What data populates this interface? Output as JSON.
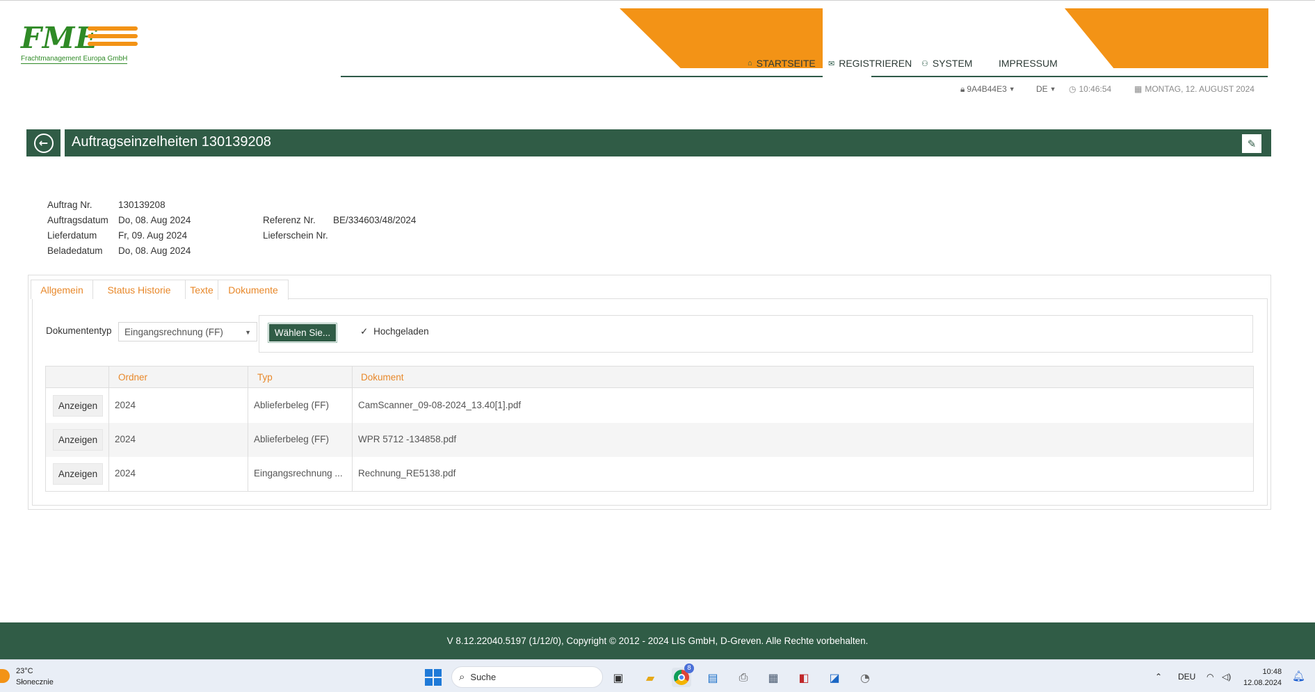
{
  "logo": {
    "mark": "FME",
    "company": "Frachtmanagement Europa GmbH"
  },
  "nav": {
    "home": "STARTSEITE",
    "register": "REGISTRIEREN",
    "system": "SYSTEM",
    "imprint": "IMPRESSUM"
  },
  "status": {
    "user": "9A4B44E3",
    "lang": "DE",
    "time": "10:46:54",
    "date": "MONTAG, 12. AUGUST 2024"
  },
  "page": {
    "title": "Auftragseinzelheiten 130139208"
  },
  "details": {
    "order_no_label": "Auftrag Nr.",
    "order_no": "130139208",
    "order_date_label": "Auftragsdatum",
    "order_date": "Do, 08. Aug 2024",
    "delivery_date_label": "Lieferdatum",
    "delivery_date": "Fr, 09. Aug 2024",
    "loading_date_label": "Beladedatum",
    "loading_date": "Do, 08. Aug 2024",
    "reference_label": "Referenz Nr.",
    "reference": "BE/334603/48/2024",
    "delivery_note_label": "Lieferschein Nr."
  },
  "tabs": [
    "Allgemein",
    "Status Historie",
    "Texte",
    "Dokumente"
  ],
  "upload": {
    "doctype_label": "Dokumententyp",
    "doctype_value": "Eingangsrechnung (FF)",
    "choose_button": "Wählen Sie...",
    "uploaded_label": "Hochgeladen"
  },
  "table": {
    "headers": [
      "Ordner",
      "Typ",
      "Dokument"
    ],
    "rows": [
      {
        "action": "Anzeigen",
        "folder": "2024",
        "type": "Ablieferbeleg (FF)",
        "document": "CamScanner_09-08-2024_13.40[1].pdf"
      },
      {
        "action": "Anzeigen",
        "folder": "2024",
        "type": "Ablieferbeleg (FF)",
        "document": "WPR 5712 -134858.pdf"
      },
      {
        "action": "Anzeigen",
        "folder": "2024",
        "type": "Eingangsrechnung ...",
        "document": "Rechnung_RE5138.pdf"
      }
    ]
  },
  "footer": {
    "text": "V 8.12.22040.5197 (1/12/0), Copyright © 2012 - 2024 LIS GmbH, D-Greven. Alle Rechte vorbehalten."
  },
  "taskbar": {
    "temperature": "23°C",
    "weather": "Słonecznie",
    "search_placeholder": "Suche",
    "language": "DEU",
    "time": "10:48",
    "date": "12.08.2024",
    "chrome_badge": "8"
  },
  "colors": {
    "brand_green": "#305c46",
    "accent_orange": "#f39316",
    "tab_text": "#e8882a"
  }
}
